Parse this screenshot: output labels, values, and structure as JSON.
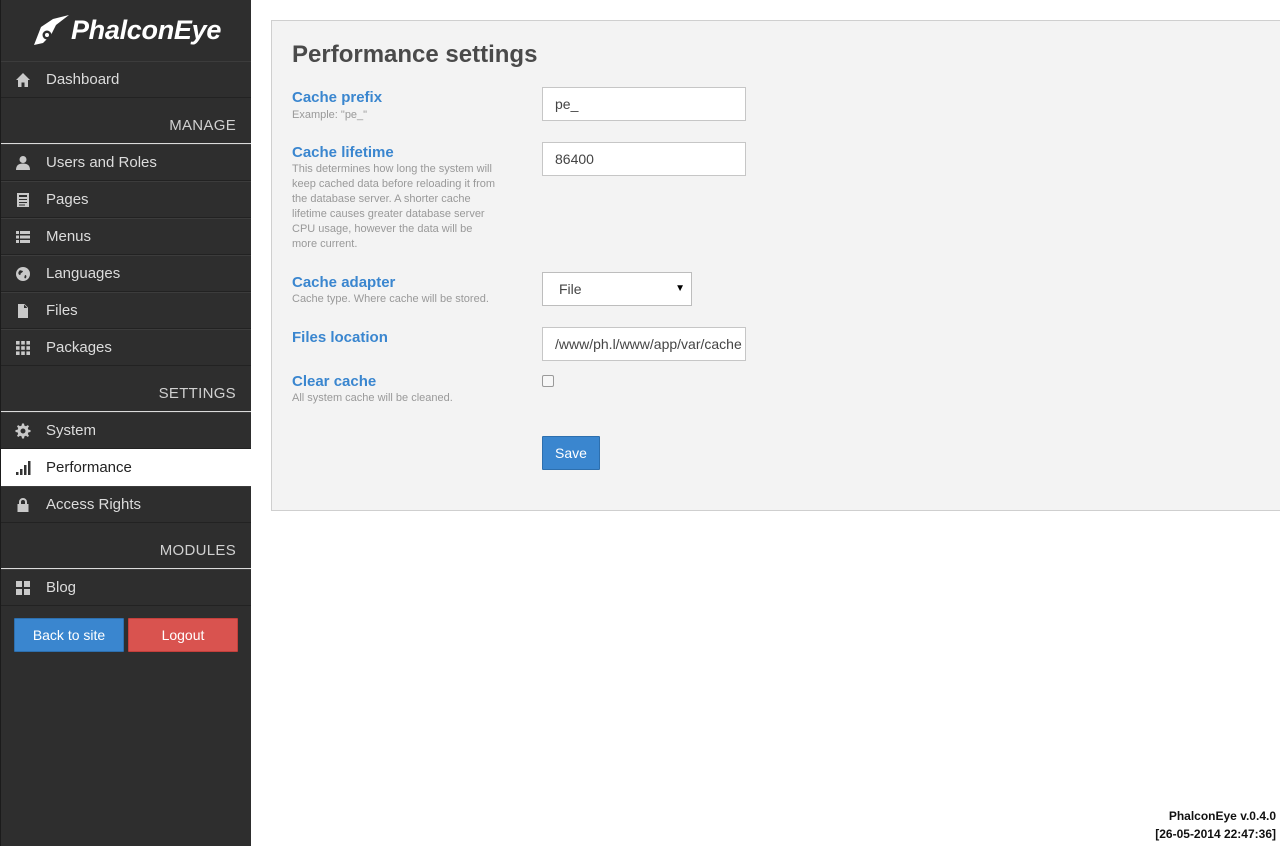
{
  "app": {
    "logo_text": "PhalconEye"
  },
  "sidebar": {
    "dashboard": "Dashboard",
    "manage_header": "MANAGE",
    "manage_items": [
      {
        "label": "Users and Roles",
        "icon": "user-icon"
      },
      {
        "label": "Pages",
        "icon": "pages-icon"
      },
      {
        "label": "Menus",
        "icon": "list-icon"
      },
      {
        "label": "Languages",
        "icon": "globe-icon"
      },
      {
        "label": "Files",
        "icon": "file-icon"
      },
      {
        "label": "Packages",
        "icon": "grid-icon"
      }
    ],
    "settings_header": "SETTINGS",
    "settings_items": [
      {
        "label": "System",
        "icon": "gear-icon"
      },
      {
        "label": "Performance",
        "icon": "signal-icon"
      },
      {
        "label": "Access Rights",
        "icon": "lock-icon"
      }
    ],
    "modules_header": "MODULES",
    "modules_items": [
      {
        "label": "Blog",
        "icon": "tiles-icon"
      }
    ],
    "back_to_site": "Back to site",
    "logout": "Logout"
  },
  "form": {
    "title": "Performance settings",
    "cache_prefix_label": "Cache prefix",
    "cache_prefix_desc": "Example: \"pe_\"",
    "cache_prefix_value": "pe_",
    "cache_lifetime_label": "Cache lifetime",
    "cache_lifetime_desc": "This determines how long the system will keep cached data before reloading it from the database server. A shorter cache lifetime causes greater database server CPU usage, however the data will be more current.",
    "cache_lifetime_value": "86400",
    "cache_adapter_label": "Cache adapter",
    "cache_adapter_desc": "Cache type. Where cache will be stored.",
    "cache_adapter_value": "File",
    "files_location_label": "Files location",
    "files_location_value": "/www/ph.l/www/app/var/cache",
    "clear_cache_label": "Clear cache",
    "clear_cache_desc": "All system cache will be cleaned.",
    "clear_cache_checked": false,
    "save_label": "Save"
  },
  "footer": {
    "version": "PhalconEye v.0.4.0",
    "timestamp": "[26-05-2014 22:47:36]"
  },
  "colors": {
    "accent": "#3a86cf",
    "danger": "#d9534f",
    "sidebar_bg": "#2e2e2e"
  }
}
